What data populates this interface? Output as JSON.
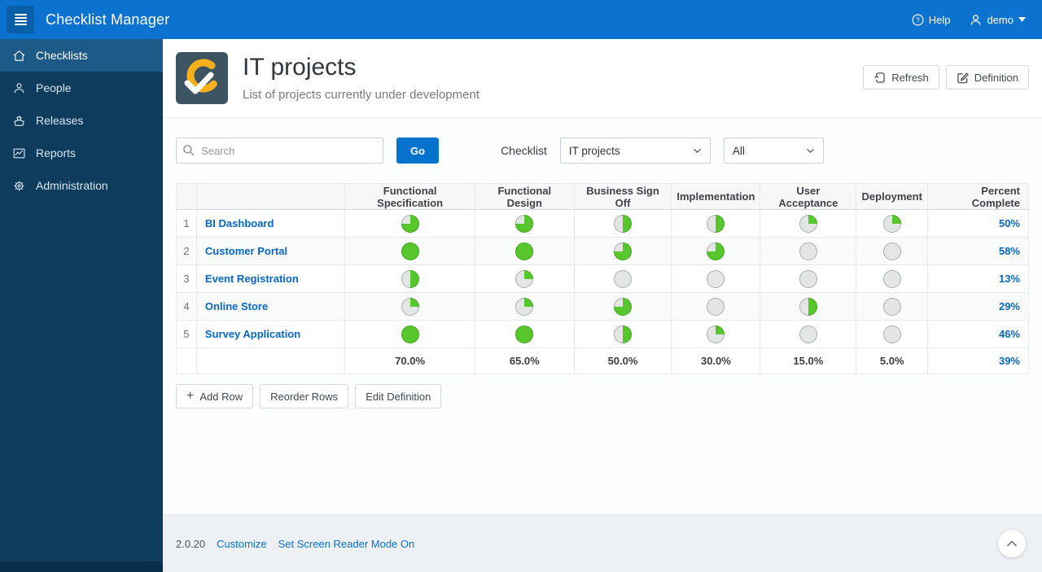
{
  "topbar": {
    "app_title": "Checklist Manager",
    "help_label": "Help",
    "user_label": "demo"
  },
  "sidebar": {
    "items": [
      {
        "label": "Checklists",
        "icon": "home",
        "active": true
      },
      {
        "label": "People",
        "icon": "person",
        "active": false
      },
      {
        "label": "Releases",
        "icon": "ship",
        "active": false
      },
      {
        "label": "Reports",
        "icon": "chart",
        "active": false
      },
      {
        "label": "Administration",
        "icon": "gear",
        "active": false
      }
    ]
  },
  "header": {
    "title": "IT projects",
    "subtitle": "List of projects currently under development",
    "refresh_label": "Refresh",
    "definition_label": "Definition"
  },
  "filters": {
    "search_placeholder": "Search",
    "go_label": "Go",
    "checklist_label": "Checklist",
    "checklist_value": "IT projects",
    "status_value": "All"
  },
  "table": {
    "stage_columns": [
      "Functional Specification",
      "Functional Design",
      "Business Sign Off",
      "Implementation",
      "User Acceptance",
      "Deployment"
    ],
    "percent_column": "Percent Complete",
    "rows": [
      {
        "num": "1",
        "name": "BI Dashboard",
        "stages": [
          75,
          75,
          50,
          50,
          25,
          25
        ],
        "percent": "50%"
      },
      {
        "num": "2",
        "name": "Customer Portal",
        "stages": [
          100,
          100,
          75,
          75,
          0,
          0
        ],
        "percent": "58%"
      },
      {
        "num": "3",
        "name": "Event Registration",
        "stages": [
          50,
          25,
          0,
          0,
          0,
          0
        ],
        "percent": "13%"
      },
      {
        "num": "4",
        "name": "Online Store",
        "stages": [
          25,
          25,
          75,
          0,
          50,
          0
        ],
        "percent": "29%"
      },
      {
        "num": "5",
        "name": "Survey Application",
        "stages": [
          100,
          100,
          50,
          25,
          0,
          0
        ],
        "percent": "46%"
      }
    ],
    "summary_values": [
      "70.0%",
      "65.0%",
      "50.0%",
      "30.0%",
      "15.0%",
      "5.0%"
    ],
    "summary_percent": "39%"
  },
  "actions": {
    "add_row_label": "Add Row",
    "reorder_rows_label": "Reorder Rows",
    "edit_definition_label": "Edit Definition"
  },
  "footer": {
    "version": "2.0.20",
    "customize_label": "Customize",
    "screen_reader_label": "Set Screen Reader Mode On"
  },
  "colors": {
    "topbar": "#0b72cf",
    "sidebar": "#0e3c5c",
    "sidebar_active": "#1d5a87",
    "accent": "#0572ce",
    "link": "#0667c5",
    "pie_done": "#57c72d",
    "pie_todo": "#e4e5e5",
    "pie_done_edge": "#3fa51d",
    "pie_todo_edge": "#aaaeb1"
  }
}
